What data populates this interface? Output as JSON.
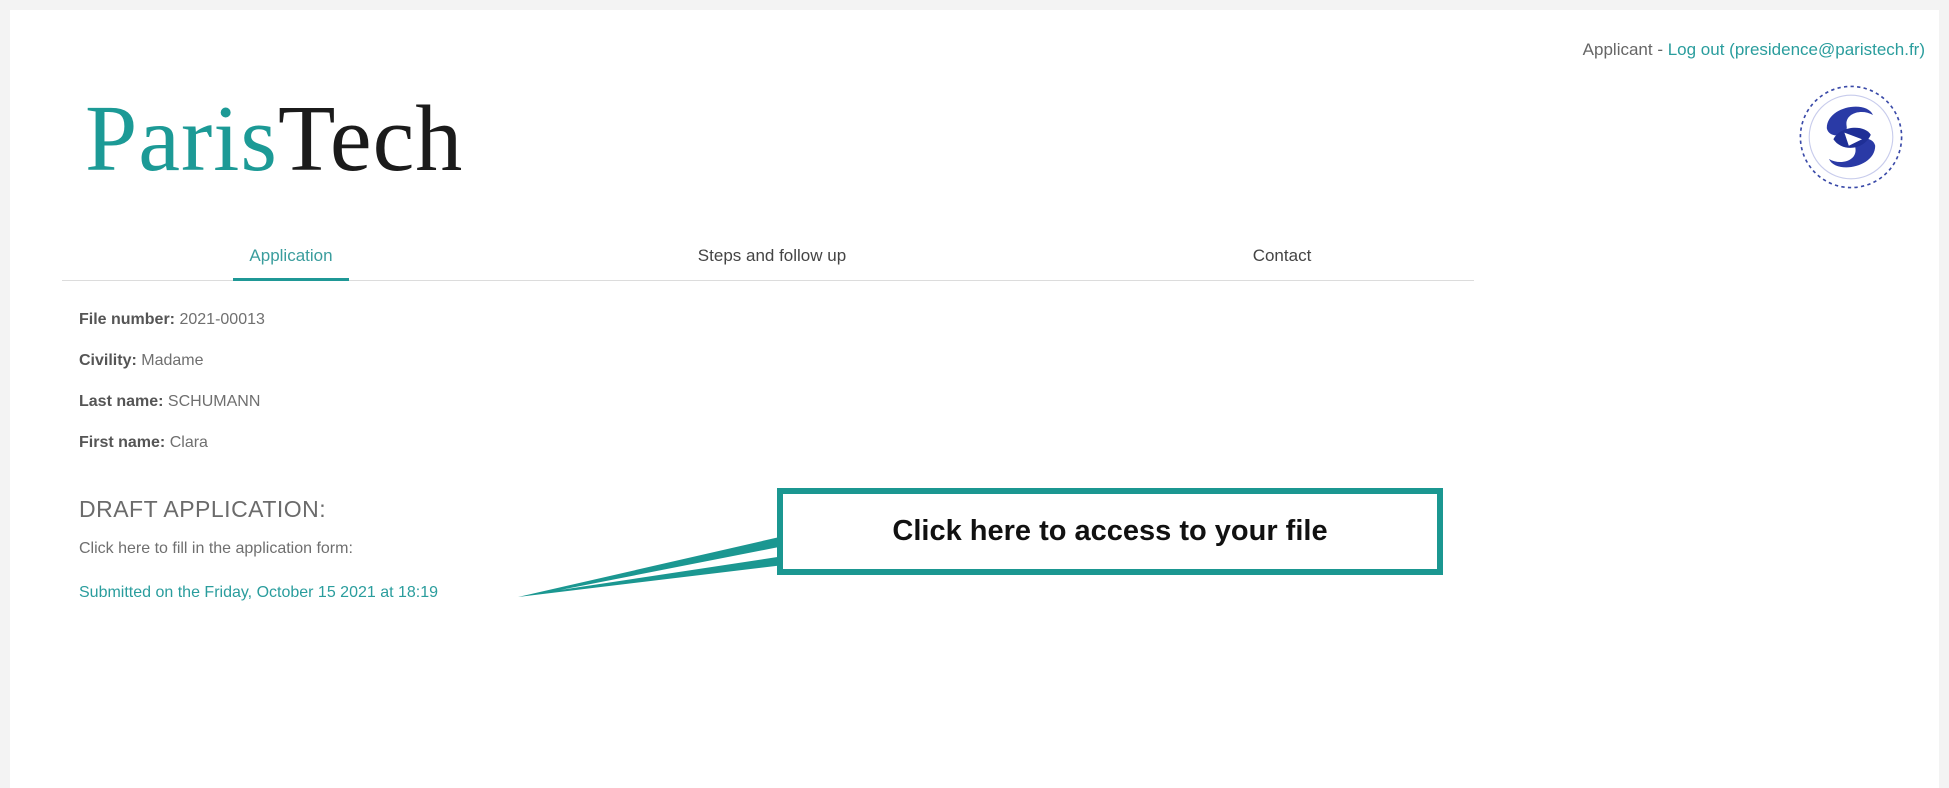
{
  "header": {
    "role_prefix": "Applicant - ",
    "logout_label": "Log out (presidence@paristech.fr)"
  },
  "logo": {
    "part1": "Paris",
    "part2": "Tech"
  },
  "seal": {
    "icon": "china-scholarship-council-seal-icon"
  },
  "nav": {
    "tabs": [
      {
        "label": "Application",
        "active": true
      },
      {
        "label": "Steps and follow up",
        "active": false
      },
      {
        "label": "Contact",
        "active": false
      }
    ]
  },
  "applicant": {
    "file_number_label": "File number:",
    "file_number": "2021-00013",
    "civility_label": "Civility:",
    "civility": "Madame",
    "last_name_label": "Last name:",
    "last_name": "SCHUMANN",
    "first_name_label": "First name:",
    "first_name": "Clara"
  },
  "draft": {
    "title": "DRAFT APPLICATION:",
    "instruction": "Click here to fill in the application form:",
    "submitted_link": "Submitted on the Friday, October 15 2021 at 18:19"
  },
  "callout": {
    "text": "Click here to access to your file"
  },
  "colors": {
    "accent": "#1b9791",
    "link": "#2a9d9d",
    "background": "#f3f3f3"
  }
}
